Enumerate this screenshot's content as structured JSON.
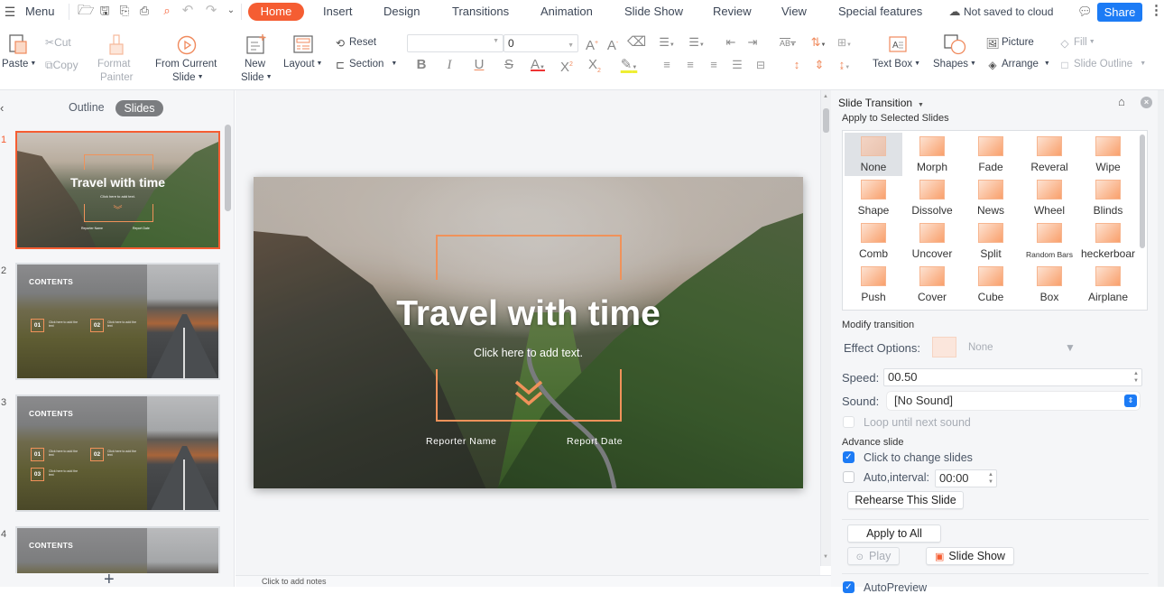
{
  "topbar": {
    "menu_label": "Menu",
    "tabs": [
      "Home",
      "Insert",
      "Design",
      "Transitions",
      "Animation",
      "Slide Show",
      "Review",
      "View",
      "Special features"
    ],
    "active_tab": "Home",
    "cloud_status": "Not saved to cloud",
    "share_label": "Share"
  },
  "ribbon": {
    "paste": "Paste",
    "cut": "Cut",
    "copy": "Copy",
    "format_painter_1": "Format",
    "format_painter_2": "Painter",
    "from_current_1": "From Current",
    "from_current_2": "Slide",
    "new_slide_1": "New",
    "new_slide_2": "Slide",
    "layout": "Layout",
    "reset": "Reset",
    "section": "Section",
    "font_name": "",
    "font_size": "0",
    "text_box": "Text Box",
    "shapes": "Shapes",
    "picture": "Picture",
    "arrange": "Arrange",
    "fill": "Fill",
    "slide_outline": "Slide Outline"
  },
  "left_panel": {
    "tabs": [
      "Outline",
      "Slides"
    ],
    "active_tab": "Slides",
    "slides": [
      {
        "number": "1",
        "title": "Travel with time",
        "subtitle": "Click here to add text.",
        "reporter": "Reporter Name",
        "date": "Report Date",
        "selected": true
      },
      {
        "number": "2",
        "title": "CONTENTS",
        "items": [
          "01",
          "02"
        ],
        "item_text": "Click here to add the text"
      },
      {
        "number": "3",
        "title": "CONTENTS",
        "items": [
          "01",
          "02",
          "03"
        ],
        "item_text": "Click here to add the text"
      },
      {
        "number": "4",
        "title": "CONTENTS"
      }
    ],
    "add_slide": "+"
  },
  "slide": {
    "title": "Travel with time",
    "subtitle": "Click here to add text.",
    "reporter": "Reporter Name",
    "date": "Report Date",
    "accent": "#f0925a"
  },
  "notes_placeholder": "Click to add notes",
  "transition_panel": {
    "title": "Slide Transition",
    "apply_label": "Apply to Selected Slides",
    "transitions": [
      "None",
      "Morph",
      "Fade",
      "Reveral",
      "Wipe",
      "Shape",
      "Dissolve",
      "News",
      "Wheel",
      "Blinds",
      "Comb",
      "Uncover",
      "Split",
      "Random Bars",
      "heckerboar",
      "Push",
      "Cover",
      "Cube",
      "Box",
      "Airplane"
    ],
    "selected": "None",
    "modify_label": "Modify transition",
    "effect_options_label": "Effect Options:",
    "effect_options_value": "None",
    "speed_label": "Speed:",
    "speed_value": "00.50",
    "sound_label": "Sound:",
    "sound_value": "[No Sound]",
    "loop_label": "Loop until next sound",
    "advance_label": "Advance slide",
    "click_change_label": "Click to change slides",
    "click_change_checked": true,
    "auto_interval_label": "Auto,interval:",
    "auto_interval_checked": false,
    "auto_interval_value": "00:00",
    "rehearse_label": "Rehearse This Slide",
    "apply_all_label": "Apply to All",
    "play_label": "Play",
    "slideshow_label": "Slide Show",
    "autopreview_label": "AutoPreview",
    "autopreview_checked": true
  },
  "colors": {
    "accent": "#f55d32",
    "share_blue": "#1c7bf5",
    "transition_orange": "#f9a06c"
  }
}
